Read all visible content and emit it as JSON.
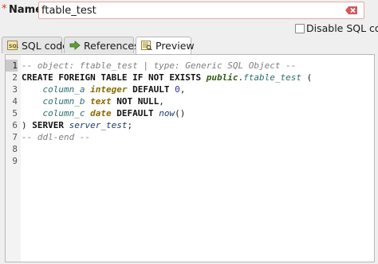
{
  "form": {
    "required_marker": "*",
    "name_label": "Name:",
    "name_value": "ftable_test",
    "disable_sql_code_label": "Disable SQL code",
    "disable_sql_code_checked": false
  },
  "tabs": [
    {
      "label": "SQL code",
      "icon": "sql-icon",
      "active": false
    },
    {
      "label": "References",
      "icon": "arrow-right-icon",
      "active": false
    },
    {
      "label": "Preview",
      "icon": "preview-icon",
      "active": true
    }
  ],
  "editor": {
    "current_line": 1,
    "line_numbers": [
      "1",
      "2",
      "3",
      "4",
      "5",
      "6",
      "7",
      "8",
      "9"
    ],
    "lines": {
      "l1": "-- object: ftable_test | type: Generic SQL Object --",
      "l2_kw": "CREATE FOREIGN TABLE IF NOT EXISTS ",
      "l2_schema": "public",
      "l2_dot": ".",
      "l2_table": "ftable_test",
      "l2_paren": " (",
      "l3_col": "column_a",
      "l3_type": "integer",
      "l3_kw": "DEFAULT",
      "l3_num": "0",
      "l3_end": ",",
      "l4_col": "column_b",
      "l4_type": "text",
      "l4_kw": "NOT NULL",
      "l4_end": ",",
      "l5_col": "column_c",
      "l5_type": "date",
      "l5_kw": "DEFAULT",
      "l5_fn": "now",
      "l5_end": "()",
      "l6_paren": ")",
      "l6_kw": "SERVER",
      "l6_server": "server_test",
      "l6_end": ";",
      "l7": "-- ddl-end --"
    }
  },
  "colors": {
    "required": "#d8341e",
    "clear_icon": "#d05a5a",
    "keyword": "#111111",
    "type": "#8a6b00",
    "schema": "#2f5a12",
    "identifier": "#2a6c6c",
    "comment": "#7f7f7f"
  }
}
